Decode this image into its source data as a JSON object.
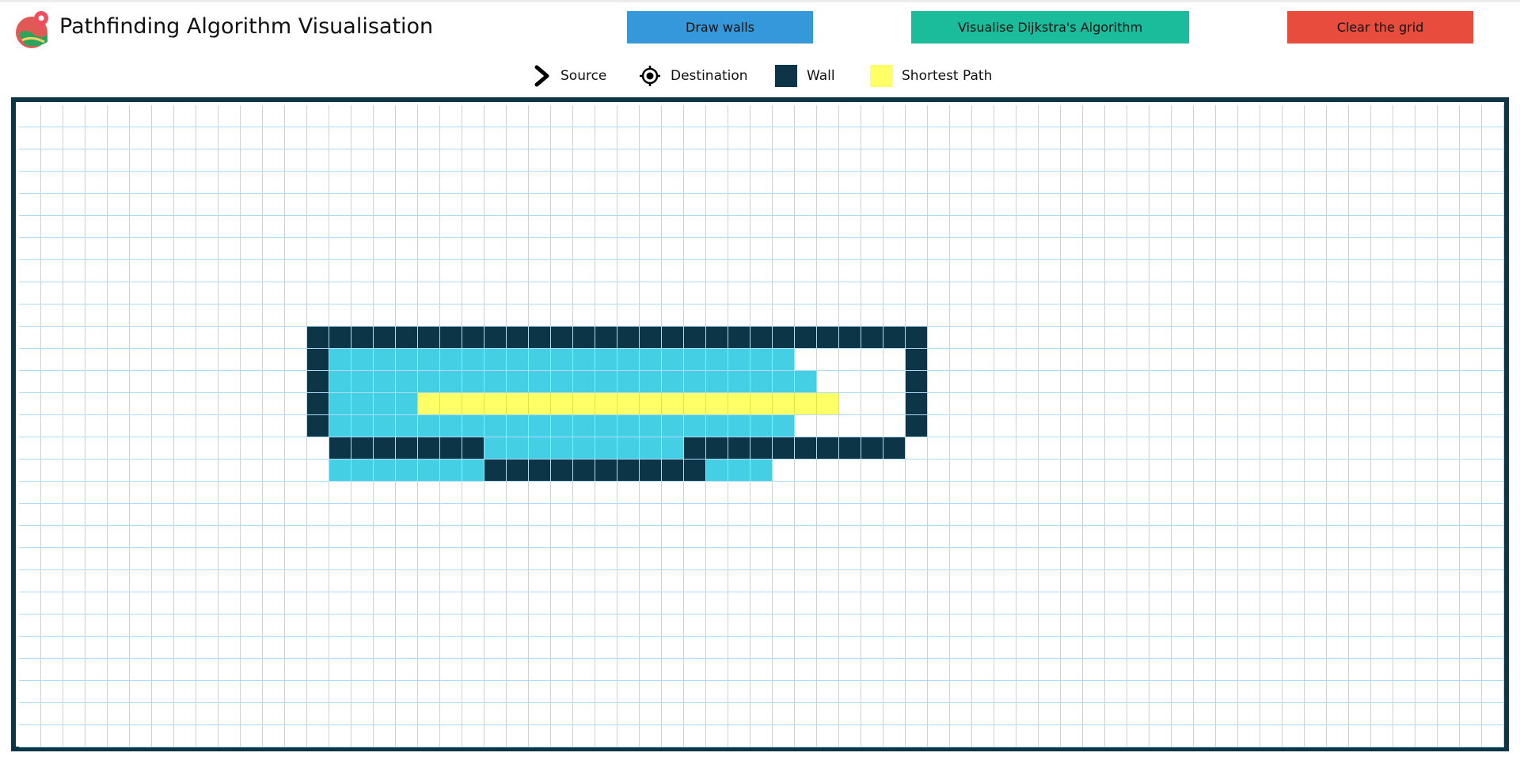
{
  "app": {
    "title": "Pathfinding Algorithm Visualisation",
    "logo_icon": "map-pin-logo-icon"
  },
  "toolbar": {
    "draw_walls_label": "Draw walls",
    "visualise_label": "Visualise Dijkstra's Algorithm",
    "clear_label": "Clear the grid"
  },
  "legend": {
    "source_label": "Source",
    "destination_label": "Destination",
    "wall_label": "Wall",
    "path_label": "Shortest Path"
  },
  "colors": {
    "wall": "#0c3547",
    "visited": "#44cfe4",
    "path": "#ffff66",
    "grid_line": "#aedaf2",
    "btn_blue": "#3498db",
    "btn_teal": "#1abc9c",
    "btn_red": "#e74c3c"
  },
  "icons": {
    "source": "chevron-right-icon",
    "destination": "target-icon"
  },
  "grid": {
    "cols": 67,
    "rows": 29,
    "walls": [
      [
        10,
        13
      ],
      [
        10,
        14
      ],
      [
        10,
        15
      ],
      [
        10,
        16
      ],
      [
        10,
        17
      ],
      [
        10,
        18
      ],
      [
        10,
        19
      ],
      [
        10,
        20
      ],
      [
        10,
        21
      ],
      [
        10,
        22
      ],
      [
        10,
        23
      ],
      [
        10,
        24
      ],
      [
        10,
        25
      ],
      [
        10,
        26
      ],
      [
        10,
        27
      ],
      [
        10,
        28
      ],
      [
        10,
        29
      ],
      [
        10,
        30
      ],
      [
        10,
        31
      ],
      [
        10,
        32
      ],
      [
        10,
        33
      ],
      [
        10,
        34
      ],
      [
        10,
        35
      ],
      [
        10,
        36
      ],
      [
        10,
        37
      ],
      [
        10,
        38
      ],
      [
        10,
        39
      ],
      [
        10,
        40
      ],
      [
        11,
        13
      ],
      [
        11,
        40
      ],
      [
        12,
        13
      ],
      [
        12,
        40
      ],
      [
        13,
        13
      ],
      [
        13,
        40
      ],
      [
        14,
        13
      ],
      [
        14,
        40
      ],
      [
        15,
        14
      ],
      [
        15,
        15
      ],
      [
        15,
        16
      ],
      [
        15,
        17
      ],
      [
        15,
        18
      ],
      [
        15,
        19
      ],
      [
        15,
        20
      ],
      [
        15,
        30
      ],
      [
        15,
        31
      ],
      [
        15,
        32
      ],
      [
        15,
        33
      ],
      [
        15,
        34
      ],
      [
        15,
        35
      ],
      [
        15,
        36
      ],
      [
        15,
        37
      ],
      [
        15,
        38
      ],
      [
        15,
        39
      ],
      [
        16,
        21
      ],
      [
        16,
        22
      ],
      [
        16,
        23
      ],
      [
        16,
        24
      ],
      [
        16,
        25
      ],
      [
        16,
        26
      ],
      [
        16,
        27
      ],
      [
        16,
        28
      ],
      [
        16,
        29
      ],
      [
        16,
        30
      ]
    ],
    "visited": [
      [
        11,
        14
      ],
      [
        11,
        15
      ],
      [
        11,
        16
      ],
      [
        11,
        17
      ],
      [
        11,
        18
      ],
      [
        11,
        19
      ],
      [
        11,
        20
      ],
      [
        11,
        21
      ],
      [
        11,
        22
      ],
      [
        11,
        23
      ],
      [
        11,
        24
      ],
      [
        11,
        25
      ],
      [
        11,
        26
      ],
      [
        11,
        27
      ],
      [
        11,
        28
      ],
      [
        11,
        29
      ],
      [
        11,
        30
      ],
      [
        11,
        31
      ],
      [
        11,
        32
      ],
      [
        11,
        33
      ],
      [
        11,
        34
      ],
      [
        12,
        14
      ],
      [
        12,
        15
      ],
      [
        12,
        16
      ],
      [
        12,
        17
      ],
      [
        12,
        18
      ],
      [
        12,
        19
      ],
      [
        12,
        20
      ],
      [
        12,
        21
      ],
      [
        12,
        22
      ],
      [
        12,
        23
      ],
      [
        12,
        24
      ],
      [
        12,
        25
      ],
      [
        12,
        26
      ],
      [
        12,
        27
      ],
      [
        12,
        28
      ],
      [
        12,
        29
      ],
      [
        12,
        30
      ],
      [
        12,
        31
      ],
      [
        12,
        32
      ],
      [
        12,
        33
      ],
      [
        12,
        34
      ],
      [
        12,
        35
      ],
      [
        13,
        14
      ],
      [
        13,
        15
      ],
      [
        13,
        16
      ],
      [
        13,
        17
      ],
      [
        14,
        14
      ],
      [
        14,
        15
      ],
      [
        14,
        16
      ],
      [
        14,
        17
      ],
      [
        14,
        18
      ],
      [
        14,
        19
      ],
      [
        14,
        20
      ],
      [
        14,
        21
      ],
      [
        14,
        22
      ],
      [
        14,
        23
      ],
      [
        14,
        24
      ],
      [
        14,
        25
      ],
      [
        14,
        26
      ],
      [
        14,
        27
      ],
      [
        14,
        28
      ],
      [
        14,
        29
      ],
      [
        14,
        30
      ],
      [
        14,
        31
      ],
      [
        14,
        32
      ],
      [
        14,
        33
      ],
      [
        14,
        34
      ],
      [
        15,
        21
      ],
      [
        15,
        22
      ],
      [
        15,
        23
      ],
      [
        15,
        24
      ],
      [
        15,
        25
      ],
      [
        15,
        26
      ],
      [
        15,
        27
      ],
      [
        15,
        28
      ],
      [
        15,
        29
      ],
      [
        16,
        14
      ],
      [
        16,
        15
      ],
      [
        16,
        16
      ],
      [
        16,
        17
      ],
      [
        16,
        18
      ],
      [
        16,
        19
      ],
      [
        16,
        20
      ],
      [
        16,
        21
      ],
      [
        16,
        22
      ],
      [
        16,
        23
      ],
      [
        16,
        24
      ],
      [
        16,
        25
      ],
      [
        16,
        26
      ],
      [
        16,
        27
      ],
      [
        16,
        28
      ],
      [
        16,
        29
      ],
      [
        16,
        30
      ],
      [
        16,
        31
      ],
      [
        16,
        32
      ],
      [
        16,
        33
      ]
    ],
    "path": [
      [
        13,
        18
      ],
      [
        13,
        19
      ],
      [
        13,
        20
      ],
      [
        13,
        21
      ],
      [
        13,
        22
      ],
      [
        13,
        23
      ],
      [
        13,
        24
      ],
      [
        13,
        25
      ],
      [
        13,
        26
      ],
      [
        13,
        27
      ],
      [
        13,
        28
      ],
      [
        13,
        29
      ],
      [
        13,
        30
      ],
      [
        13,
        31
      ],
      [
        13,
        32
      ],
      [
        13,
        33
      ],
      [
        13,
        34
      ],
      [
        13,
        35
      ],
      [
        13,
        36
      ]
    ]
  }
}
